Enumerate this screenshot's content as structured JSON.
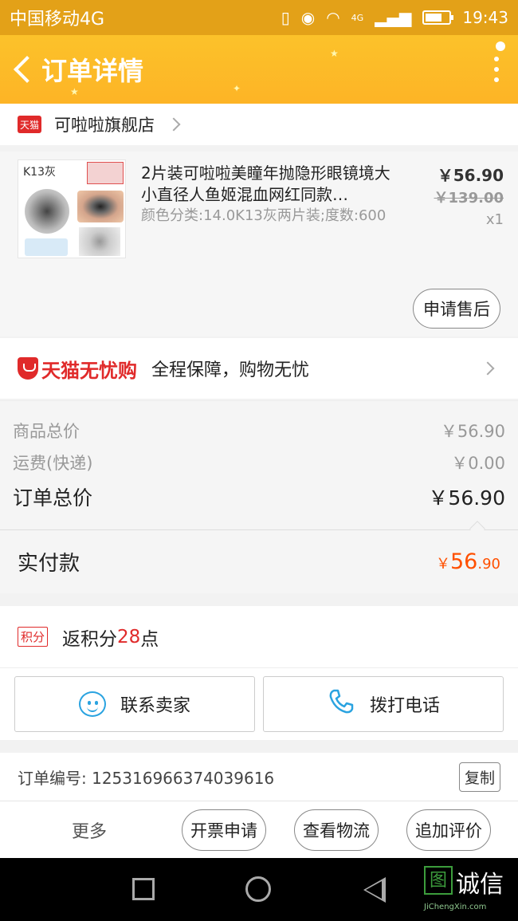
{
  "status": {
    "carrier": "中国移动4G",
    "network": "4G",
    "time": "19:43",
    "battery_level": 0.7
  },
  "header": {
    "title": "订单详情"
  },
  "shop": {
    "badge": "天猫",
    "name": "可啦啦旗舰店"
  },
  "product": {
    "thumb_label": "K13灰",
    "title": "2片装可啦啦美瞳年抛隐形眼镜境大小直径人鱼姬混血网红同款…",
    "spec": "颜色分类:14.0K13灰两片装;度数:600",
    "price": "￥56.90",
    "original_price": "￥139.00",
    "quantity": "x1",
    "after_sale_label": "申请售后"
  },
  "guarantee": {
    "brand": "天猫无忧购",
    "text": "全程保障，购物无忧"
  },
  "summary": {
    "goods_label": "商品总价",
    "goods_value": "￥56.90",
    "shipping_label": "运费(快递)",
    "shipping_value": "￥0.00",
    "total_label": "订单总价",
    "total_value": "￥56.90"
  },
  "payment": {
    "label": "实付款",
    "currency": "￥",
    "integer": "56",
    "decimal": ".90"
  },
  "points": {
    "badge": "积分",
    "prefix": "返积分",
    "value": "28",
    "suffix": "点"
  },
  "contact": {
    "seller_label": "联系卖家",
    "phone_label": "拨打电话"
  },
  "order": {
    "number_text": "订单编号: 125316966374039616",
    "copy_label": "复制"
  },
  "actions": {
    "more": "更多",
    "invoice": "开票申请",
    "logistics": "查看物流",
    "review": "追加评价"
  },
  "watermark": {
    "logo": "图",
    "text": "诚信",
    "url": "JiChengXin.com"
  },
  "colors": {
    "accent": "#fdb426",
    "price_orange": "#ff5000",
    "tmall_red": "#e02a2a",
    "icon_blue": "#2aa3e0"
  }
}
